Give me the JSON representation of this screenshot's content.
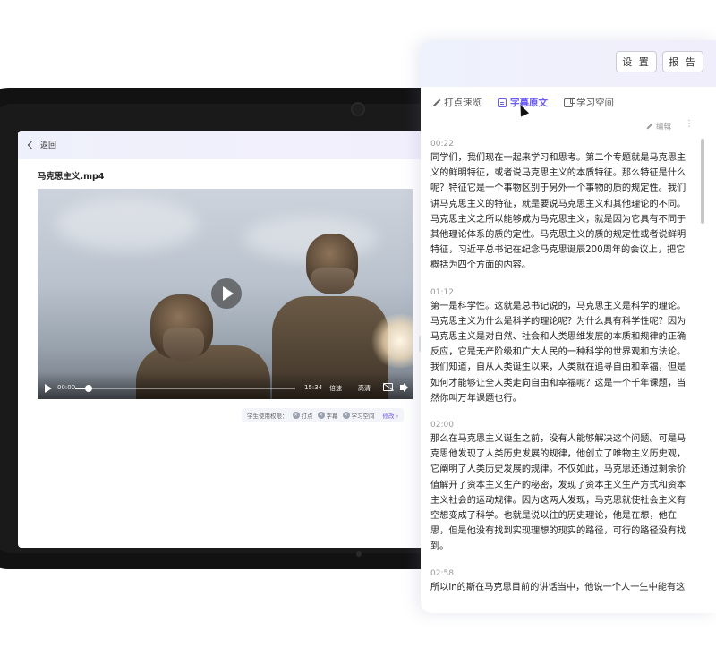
{
  "device": {
    "back_label": "返回",
    "file_title": "马克思主义.mp4",
    "video": {
      "current_time": "00:00",
      "total_time": "15:34",
      "speed_label": "倍速",
      "quality_label": "高清",
      "progress_fraction": 0.06
    },
    "permissions": {
      "label": "学生使用权限：",
      "items": [
        "打点",
        "字幕",
        "学习空间"
      ],
      "edit_label": "修改"
    }
  },
  "panel": {
    "settings_label": "设 置",
    "report_label": "报 告",
    "tabs": [
      {
        "label": "打点速览",
        "icon": "magic-wand-icon",
        "active": false
      },
      {
        "label": "字幕原文",
        "icon": "document-icon",
        "active": true
      },
      {
        "label": "学习空间",
        "icon": "workspace-icon",
        "active": false
      }
    ],
    "edit_label": "编辑",
    "transcript": [
      {
        "time": "00:22",
        "text": "同学们，我们现在一起来学习和思考。第二个专题就是马克思主义的鲜明特征，或者说马克思主义的本质特征。那么特征是什么呢？特征它是一个事物区别于另外一个事物的质的规定性。我们讲马克思主义的特征，就是要说马克思主义和其他理论的不同。马克思主义之所以能够成为马克思主义，就是因为它具有不同于其他理论体系的质的定性。马克思主义的质的规定性或者说鲜明特征，习近平总书记在纪念马克思诞辰200周年的会议上，把它概括为四个方面的内容。"
      },
      {
        "time": "01:12",
        "text": "第一是科学性。这就是总书记说的，马克思主义是科学的理论。马克思主义为什么是科学的理论呢？为什么具有科学性呢？因为马克思主义是对自然、社会和人类思维发展的本质和规律的正确反应，它是无产阶级和广大人民的一种科学的世界观和方法论。我们知道，自从人类诞生以来，人类就在追寻自由和幸福，但是如何才能够让全人类走向自由和幸福呢？这是一个千年课题，当然你叫万年课题也行。"
      },
      {
        "time": "02:00",
        "text": "那么在马克思主义诞生之前，没有人能够解决这个问题。可是马克思他发现了人类历史发展的规律，他创立了唯物主义历史观，它阐明了人类历史发展的规律。不仅如此，马克思还通过剩余价值解开了资本主义生产的秘密，发现了资本主义生产方式和资本主义社会的运动规律。因为这两大发现，马克思就使社会主义有空想变成了科学。也就是说以往的历史理论，他是在想，他在思，但是他没有找到实现理想的现实的路径，可行的路径没有找到。"
      },
      {
        "time": "02:58",
        "text": "所以in的斯在马克思目前的讲话当中，他说一个人一生中能有这"
      }
    ]
  }
}
